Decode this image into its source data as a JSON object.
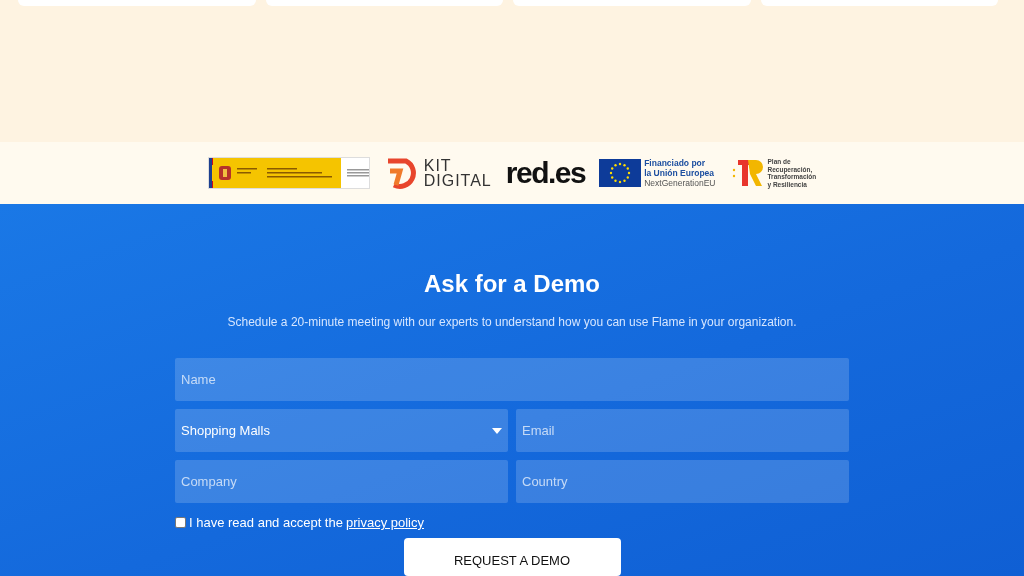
{
  "logos": {
    "kit_digital": {
      "line_1": "KIT",
      "line_2": "DIGITAL"
    },
    "redes": "red.es",
    "eu": {
      "line_1": "Financiado por",
      "line_2": "la Unión Europea",
      "line_3": "NextGenerationEU"
    },
    "plan": {
      "line_1": "Plan de",
      "line_2": "Recuperación,",
      "line_3": "Transformación",
      "line_4": "y Resiliencia"
    }
  },
  "demo": {
    "title": "Ask for a Demo",
    "subtitle": "Schedule a 20-minute meeting with our experts to understand how you can use Flame in your organization.",
    "fields": [
      {
        "kind": "input",
        "placeholder": "Name",
        "wide": true
      },
      {
        "kind": "select",
        "value": "Shopping Malls",
        "wide": false
      },
      {
        "kind": "input",
        "placeholder": "Email",
        "wide": false
      },
      {
        "kind": "input",
        "placeholder": "Company",
        "wide": false
      },
      {
        "kind": "input",
        "placeholder": "Country",
        "wide": false
      }
    ],
    "consent": {
      "checked": false,
      "text": "I have read and accept the",
      "link": "privacy policy"
    },
    "button": "REQUEST A DEMO"
  }
}
